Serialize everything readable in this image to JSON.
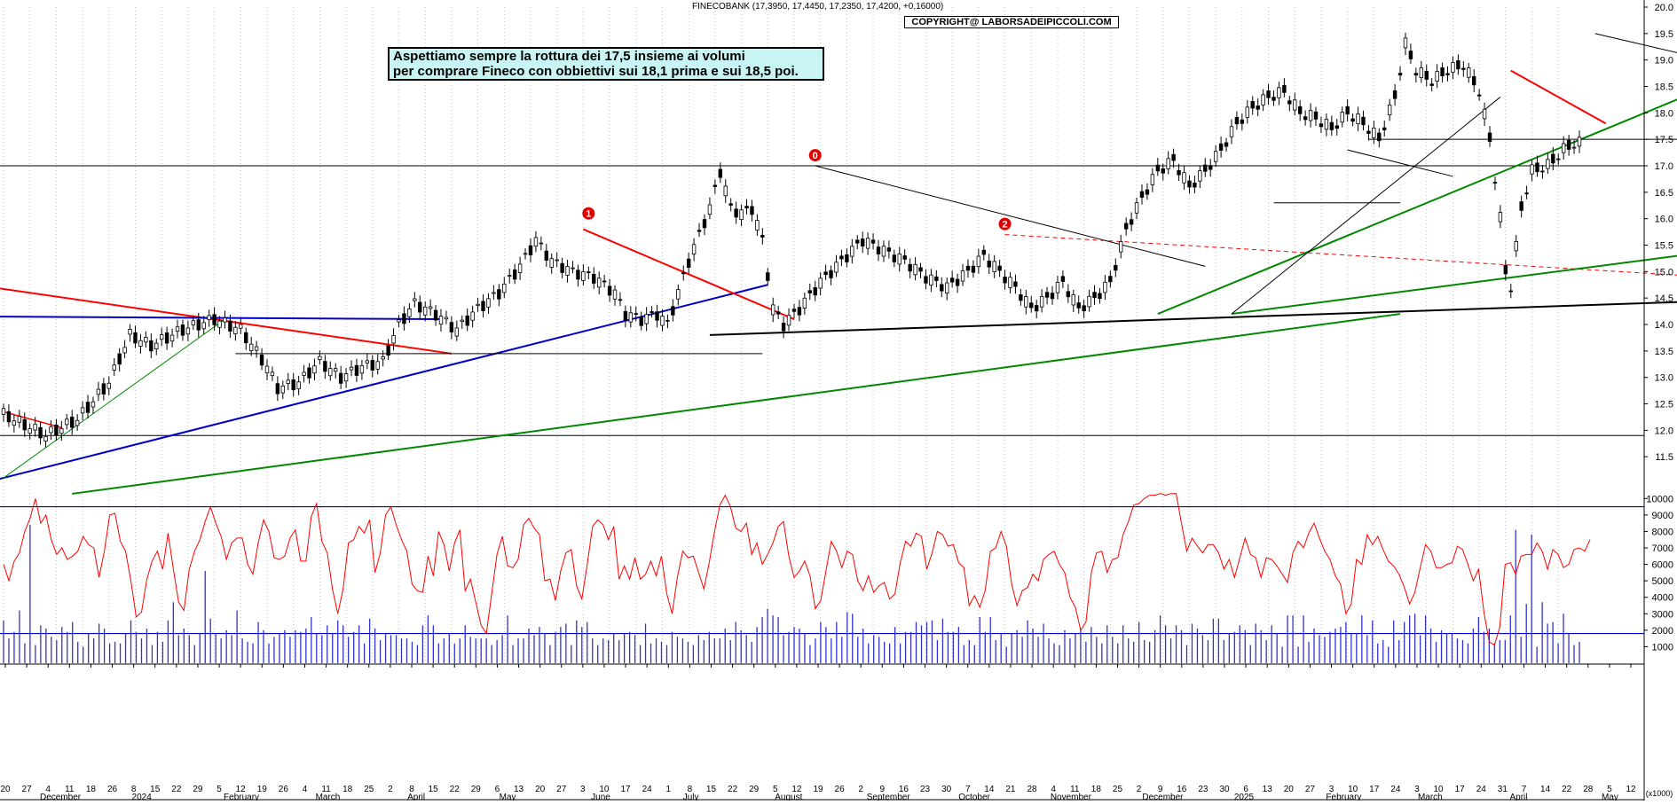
{
  "header": {
    "ticker_line": "FINECOBANK (17,3950, 17,4450, 17,2350, 17,4200, +0,16000)",
    "copyright": "COPYRIGHT@ LABORSADEIPICCOLI.COM"
  },
  "annotation": {
    "line1": "Aspettiamo sempre la rottura dei 17,5 insieme ai volumi",
    "line2": "per comprare Fineco con obbiettivi sui 18,1 prima e sui 18,5 poi."
  },
  "wave_labels": [
    "1",
    "0",
    "2"
  ],
  "colors": {
    "up_candle": "#ffffff",
    "down_candle": "#000000",
    "grid": "#b0b0b0",
    "volume_bar": "#3333cc",
    "oscillator": "#ff0000",
    "trend_red": "#ff0000",
    "trend_blue": "#0000cc",
    "trend_green": "#008800",
    "level_black": "#000000",
    "wave_marker": "#e00000"
  },
  "chart_data": [
    {
      "type": "candlestick",
      "title": "FINECOBANK",
      "ylim": [
        11.0,
        20.0
      ],
      "y_ticks": [
        "11.5",
        "12.0",
        "12.5",
        "13.0",
        "13.5",
        "14.0",
        "14.5",
        "15.0",
        "15.5",
        "16.0",
        "16.5",
        "17.0",
        "17.5",
        "18.0",
        "18.5",
        "19.0",
        "19.5",
        "20.0"
      ],
      "x_day_labels": [
        "20",
        "27",
        "4",
        "11",
        "18",
        "26",
        "8",
        "15",
        "22",
        "29",
        "5",
        "12",
        "19",
        "26",
        "4",
        "11",
        "18",
        "25",
        "2",
        "8",
        "15",
        "22",
        "29",
        "6",
        "13",
        "20",
        "27",
        "3",
        "10",
        "17",
        "24",
        "1",
        "8",
        "15",
        "22",
        "29",
        "5",
        "12",
        "19",
        "26",
        "2",
        "9",
        "16",
        "23",
        "30",
        "7",
        "14",
        "21",
        "28",
        "4",
        "11",
        "18",
        "25",
        "2",
        "9",
        "16",
        "23",
        "30",
        "6",
        "13",
        "20",
        "27",
        "3",
        "10",
        "17",
        "24",
        "3",
        "10",
        "17",
        "24",
        "31",
        "7",
        "14",
        "22",
        "28",
        "5",
        "12"
      ],
      "x_month_labels": [
        "December",
        "2024",
        "February",
        "March",
        "April",
        "May",
        "June",
        "July",
        "August",
        "September",
        "October",
        "November",
        "December",
        "2025",
        "February",
        "March",
        "April",
        "May"
      ],
      "horizontal_levels": [
        17.0,
        11.9
      ],
      "price_path": [
        [
          0,
          12.3
        ],
        [
          8,
          11.9
        ],
        [
          14,
          12.2
        ],
        [
          20,
          12.9
        ],
        [
          24,
          13.8
        ],
        [
          28,
          13.6
        ],
        [
          34,
          13.9
        ],
        [
          40,
          14.1
        ],
        [
          45,
          13.9
        ],
        [
          50,
          13.2
        ],
        [
          52,
          12.8
        ],
        [
          56,
          12.9
        ],
        [
          60,
          13.3
        ],
        [
          64,
          13.0
        ],
        [
          68,
          13.2
        ],
        [
          72,
          13.3
        ],
        [
          75,
          14.0
        ],
        [
          78,
          14.4
        ],
        [
          82,
          14.2
        ],
        [
          86,
          13.9
        ],
        [
          90,
          14.3
        ],
        [
          94,
          14.6
        ],
        [
          98,
          15.1
        ],
        [
          101,
          15.6
        ],
        [
          104,
          15.2
        ],
        [
          108,
          15.0
        ],
        [
          112,
          14.9
        ],
        [
          116,
          14.6
        ],
        [
          118,
          14.2
        ],
        [
          121,
          14.1
        ],
        [
          124,
          14.2
        ],
        [
          126,
          14.0
        ],
        [
          128,
          14.6
        ],
        [
          130,
          15.2
        ],
        [
          132,
          15.7
        ],
        [
          134,
          16.2
        ],
        [
          136,
          16.9
        ],
        [
          138,
          16.2
        ],
        [
          140,
          16.1
        ],
        [
          142,
          16.2
        ],
        [
          144,
          15.6
        ],
        [
          146,
          14.3
        ],
        [
          148,
          14.0
        ],
        [
          151,
          14.3
        ],
        [
          155,
          14.8
        ],
        [
          159,
          15.2
        ],
        [
          163,
          15.6
        ],
        [
          167,
          15.4
        ],
        [
          171,
          15.2
        ],
        [
          175,
          14.9
        ],
        [
          179,
          14.7
        ],
        [
          183,
          15.0
        ],
        [
          186,
          15.3
        ],
        [
          189,
          15.0
        ],
        [
          192,
          14.7
        ],
        [
          195,
          14.3
        ],
        [
          198,
          14.5
        ],
        [
          201,
          14.8
        ],
        [
          204,
          14.3
        ],
        [
          207,
          14.5
        ],
        [
          210,
          14.8
        ],
        [
          213,
          15.8
        ],
        [
          216,
          16.4
        ],
        [
          219,
          16.9
        ],
        [
          222,
          17.1
        ],
        [
          225,
          16.6
        ],
        [
          228,
          16.9
        ],
        [
          231,
          17.3
        ],
        [
          234,
          17.8
        ],
        [
          237,
          18.1
        ],
        [
          240,
          18.3
        ],
        [
          243,
          18.4
        ],
        [
          246,
          18.0
        ],
        [
          249,
          17.9
        ],
        [
          252,
          17.7
        ],
        [
          255,
          18.0
        ],
        [
          258,
          17.8
        ],
        [
          261,
          17.5
        ],
        [
          264,
          18.3
        ],
        [
          266,
          19.3
        ],
        [
          268,
          18.8
        ],
        [
          271,
          18.6
        ],
        [
          274,
          18.8
        ],
        [
          277,
          18.9
        ],
        [
          280,
          18.4
        ],
        [
          282,
          17.5
        ],
        [
          284,
          16.0
        ],
        [
          285,
          15.0
        ],
        [
          286,
          14.7
        ],
        [
          288,
          16.2
        ],
        [
          290,
          16.9
        ],
        [
          293,
          17.0
        ],
        [
          296,
          17.3
        ],
        [
          298,
          17.42
        ]
      ]
    },
    {
      "type": "bar",
      "title": "Volume",
      "ylim": [
        0,
        10500
      ],
      "y_ticks": [
        "1000",
        "2000",
        "3000",
        "4000",
        "5000",
        "6000",
        "7000",
        "8000",
        "9000",
        "10000"
      ],
      "unit_label": "(x1000)",
      "reference_levels": [
        9500,
        1800
      ],
      "series": [
        {
          "values": [
            2600,
            1500,
            1900,
            3200,
            1200,
            8400,
            1100,
            2300,
            2100,
            1600,
            1400,
            2200,
            1900,
            2500,
            1300,
            1000,
            1800,
            1500,
            2400,
            2100,
            1200,
            1300,
            1200,
            1800,
            2600,
            1900,
            1500,
            2100,
            1100,
            1900,
            1300,
            2600,
            3700,
            1700,
            2100,
            1700,
            1100,
            1800,
            5600,
            2700,
            1800,
            1500,
            2000,
            1700,
            3200,
            1500,
            1300,
            1200,
            2500,
            2000,
            1200,
            1600,
            1800,
            2000,
            1600,
            2000,
            1900,
            2100,
            2800,
            1800,
            1700,
            2300,
            1800,
            2600,
            2300,
            1600,
            1900,
            2300,
            1200,
            2700,
            2100,
            1400,
            1800,
            1700,
            1700,
            1500,
            1500,
            1300,
            1100,
            2300,
            2900,
            2300,
            1200,
            1500,
            1800,
            1200,
            1500,
            2300,
            1600,
            1500,
            1500,
            1500,
            1100,
            1400,
            1700,
            2900,
            1100,
            1500,
            1500,
            2100,
            1700,
            2200,
            1800,
            1100,
            1900,
            2200,
            2400,
            1100,
            2600,
            2200,
            2500,
            1500,
            1100,
            1500,
            1400,
            1800,
            1400,
            1800,
            1900,
            1700,
            1100,
            2400,
            1200,
            1500,
            1300,
            1100,
            1900,
            1600,
            1500,
            1300,
            1100,
            1700,
            1400,
            1900,
            1500,
            1500,
            2100,
            1400,
            2500,
            2000,
            1700,
            1300,
            2200,
            2800,
            3300,
            2900,
            2800,
            1700,
            1900,
            2200,
            2100,
            1800,
            1100,
            1500,
            2500,
            2200,
            1500,
            2500,
            1600,
            3100,
            3000,
            1600,
            2100,
            1200,
            1700,
            1600,
            1300,
            1200,
            2200,
            1200,
            1900,
            1900,
            2500,
            2300,
            2500,
            2600,
            1400,
            2700,
            1900,
            1900,
            2200,
            1100,
            1400,
            1100,
            2800,
            1900,
            2800,
            1400,
            1800,
            1000,
            1800,
            2000,
            1600,
            2600,
            2100,
            1600,
            2400,
            1500,
            1200,
            1100,
            2000,
            1500,
            1800,
            2100,
            1300,
            2200,
            1600,
            1200,
            2300,
            1600,
            1200,
            2300,
            1500,
            1300,
            2500,
            1400,
            1300,
            2000,
            2900,
            2300,
            1500,
            2300,
            2000,
            1100,
            2400,
            2100,
            1700,
            1400,
            2700,
            2700,
            1400,
            1800,
            1900,
            2300,
            2000,
            1100,
            2400,
            2000,
            1400,
            2300,
            1800,
            1000,
            2900,
            2900,
            1000,
            2900,
            1300,
            2100,
            1700,
            1600,
            1900,
            2100,
            2200,
            2500,
            1800,
            1800,
            2900,
            1700,
            2600,
            1200,
            1400,
            1000,
            2600,
            1400,
            2500,
            2900,
            3000,
            1700,
            2900,
            2100,
            1300,
            2000,
            1800,
            1800,
            1500,
            1400,
            1200,
            2100,
            2800,
            1900,
            2100,
            1200,
            1400,
            1400,
            2900,
            8100,
            1600,
            3600,
            7800,
            1000,
            3700,
            2400,
            2500,
            1200,
            3000,
            1800,
            1100,
            1300
          ]
        },
        {
          "values": [
            6000,
            5000,
            6200,
            6700,
            8000,
            8800,
            10000,
            8500,
            9000,
            7500,
            6600,
            7000,
            6300,
            6500,
            6800,
            7700,
            7200,
            7000,
            5200,
            6800,
            9000,
            9100,
            7400,
            6800,
            5000,
            2800,
            3100,
            5100,
            6200,
            6800,
            5700,
            7900,
            5700,
            3700,
            3200,
            5700,
            6800,
            7500,
            8600,
            9500,
            8500,
            7700,
            6300,
            7300,
            7600,
            7600,
            6000,
            5400,
            7300,
            8700,
            8000,
            6400,
            6300,
            6500,
            7600,
            8100,
            6200,
            6200,
            8900,
            9700,
            7400,
            6700,
            4500,
            3000,
            4500,
            7300,
            7500,
            8300,
            7900,
            8700,
            5500,
            6700,
            9000,
            9500,
            8400,
            7500,
            6800,
            4800,
            4400,
            4300,
            6500,
            5300,
            8000,
            7200,
            5600,
            7300,
            8100,
            4400,
            5100,
            3700,
            2300,
            1800,
            4200,
            6600,
            7700,
            5900,
            5800,
            6300,
            8400,
            8800,
            8200,
            7800,
            5000,
            5100,
            3800,
            5600,
            6700,
            6900,
            4700,
            3900,
            6000,
            8300,
            8700,
            8400,
            7500,
            8300,
            5100,
            5900,
            5100,
            6400,
            5100,
            5400,
            6200,
            5300,
            6500,
            4200,
            3000,
            5200,
            6800,
            6400,
            6500,
            5500,
            4500,
            6100,
            8000,
            9600,
            10200,
            9500,
            8200,
            8000,
            8500,
            6600,
            7300,
            6000,
            6600,
            7300,
            8300,
            8600,
            6500,
            5200,
            5600,
            6200,
            5300,
            3300,
            3800,
            5600,
            7400,
            6800,
            5800,
            6800,
            6600,
            5000,
            4400,
            5300,
            4300,
            4700,
            4900,
            3900,
            4200,
            6100,
            7400,
            7100,
            7900,
            7700,
            5700,
            6700,
            8000,
            7800,
            7100,
            7200,
            6100,
            5800,
            3500,
            4100,
            3400,
            4400,
            6800,
            7000,
            8000,
            7100,
            4800,
            3500,
            4400,
            4600,
            5400,
            5000,
            6300,
            6600,
            6800,
            6000,
            5500,
            4000,
            3400,
            2000,
            2500,
            5500,
            6700,
            6800,
            5500,
            6300,
            6400,
            7800,
            8600,
            9600,
            9700,
            10000,
            10200,
            10200,
            10300,
            10200,
            10300,
            10300,
            8500,
            6800,
            7600,
            7100,
            6700,
            7200,
            7200,
            6700,
            5700,
            6300,
            5200,
            6400,
            7600,
            6600,
            6400,
            5200,
            6400,
            6300,
            5900,
            5400,
            4900,
            6700,
            7400,
            7000,
            7900,
            8500,
            7600,
            6800,
            6300,
            5300,
            4800,
            3000,
            3600,
            6300,
            6000,
            7800,
            7200,
            7700,
            6900,
            6200,
            5900,
            5400,
            4600,
            3600,
            4300,
            5800,
            7200,
            6800,
            5800,
            5800,
            6000,
            6100,
            7100,
            6900,
            6000,
            5000,
            5700,
            3100,
            1300,
            1100,
            2200,
            6000,
            6100,
            5400,
            6500,
            6600,
            6600,
            7300,
            6800,
            5700,
            6900,
            6600,
            5800,
            6000,
            6900,
            7000,
            6800,
            7500
          ]
        }
      ]
    }
  ]
}
